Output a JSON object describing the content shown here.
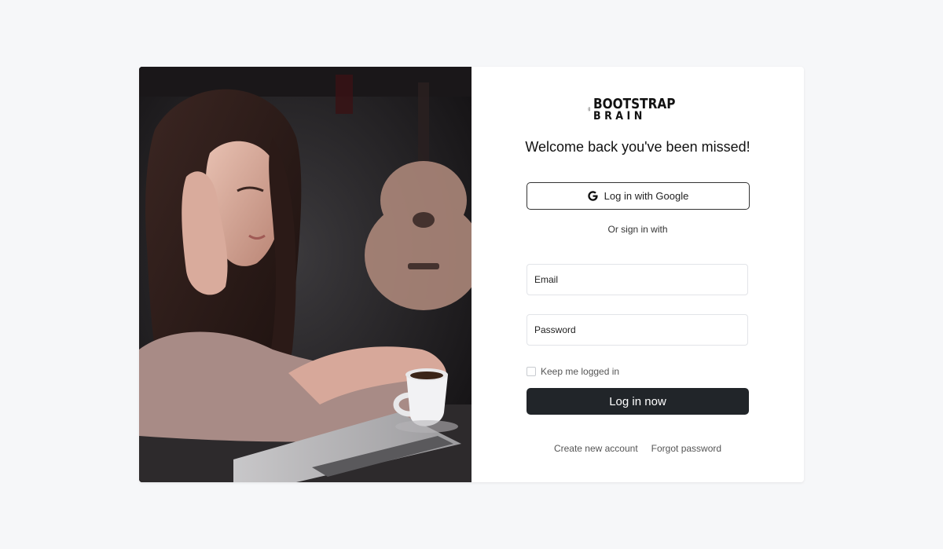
{
  "brand": {
    "line1": "BOOTSTRAP",
    "line2": "BRAIN",
    "logo_icon": "brain-icon"
  },
  "heading": "Welcome back you've been missed!",
  "google_button": {
    "label": "Log in with Google",
    "icon": "google-icon"
  },
  "divider_text": "Or sign in with",
  "fields": {
    "email_placeholder": "Email",
    "password_placeholder": "Password"
  },
  "remember_label": "Keep me logged in",
  "submit_label": "Log in now",
  "links": {
    "create_account": "Create new account",
    "forgot_password": "Forgot password"
  },
  "colors": {
    "page_background": "#f6f7f9",
    "primary_button": "#212529",
    "card": "#ffffff"
  },
  "image": {
    "icon": "photo-woman-laptop-coffee"
  }
}
